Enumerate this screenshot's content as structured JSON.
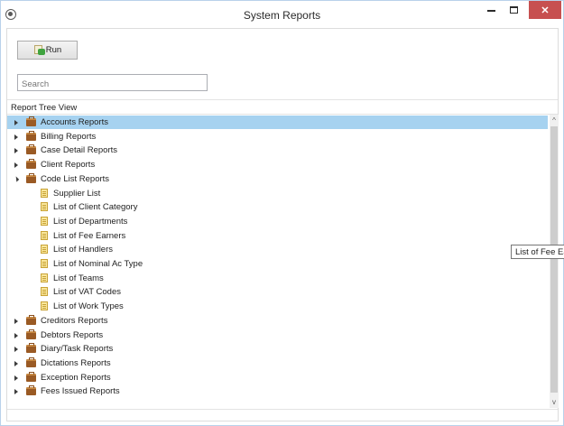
{
  "window": {
    "title": "System Reports",
    "close_glyph": "✕",
    "icons": {
      "app": "app-logo-icon",
      "minimize": "minimize-icon",
      "maximize": "maximize-icon",
      "close": "close-icon"
    }
  },
  "toolbar": {
    "run_label": "Run",
    "run_icon": "run-report-icon"
  },
  "search": {
    "placeholder": "Search",
    "value": ""
  },
  "tree": {
    "header": "Report Tree View",
    "items": [
      {
        "label": "Accounts Reports",
        "type": "folder",
        "level": 0,
        "state": "collapsed",
        "selected": true
      },
      {
        "label": "Billing Reports",
        "type": "folder",
        "level": 0,
        "state": "collapsed"
      },
      {
        "label": "Case Detail Reports",
        "type": "folder",
        "level": 0,
        "state": "collapsed"
      },
      {
        "label": "Client Reports",
        "type": "folder",
        "level": 0,
        "state": "collapsed"
      },
      {
        "label": "Code List Reports",
        "type": "folder",
        "level": 0,
        "state": "expanded"
      },
      {
        "label": "Supplier List",
        "type": "report",
        "level": 1
      },
      {
        "label": "List of Client Category",
        "type": "report",
        "level": 1
      },
      {
        "label": "List of Departments",
        "type": "report",
        "level": 1
      },
      {
        "label": "List of Fee Earners",
        "type": "report",
        "level": 1
      },
      {
        "label": "List of Handlers",
        "type": "report",
        "level": 1
      },
      {
        "label": "List of Nominal Ac Type",
        "type": "report",
        "level": 1
      },
      {
        "label": "List of Teams",
        "type": "report",
        "level": 1
      },
      {
        "label": "List of VAT Codes",
        "type": "report",
        "level": 1
      },
      {
        "label": "List of Work Types",
        "type": "report",
        "level": 1
      },
      {
        "label": "Creditors Reports",
        "type": "folder",
        "level": 0,
        "state": "collapsed"
      },
      {
        "label": "Debtors Reports",
        "type": "folder",
        "level": 0,
        "state": "collapsed"
      },
      {
        "label": "Diary/Task Reports",
        "type": "folder",
        "level": 0,
        "state": "collapsed"
      },
      {
        "label": "Dictations Reports",
        "type": "folder",
        "level": 0,
        "state": "collapsed"
      },
      {
        "label": "Exception Reports",
        "type": "folder",
        "level": 0,
        "state": "collapsed"
      },
      {
        "label": "Fees Issued Reports",
        "type": "folder",
        "level": 0,
        "state": "collapsed"
      }
    ]
  },
  "scrollbar": {
    "up_glyph": "^",
    "down_glyph": "v"
  },
  "tooltip": {
    "text": "List of Fee Ea"
  },
  "colors": {
    "selection": "#a6d2f0",
    "close_button": "#c75050",
    "folder": "#9a5a24",
    "report": "#f9e79c"
  }
}
